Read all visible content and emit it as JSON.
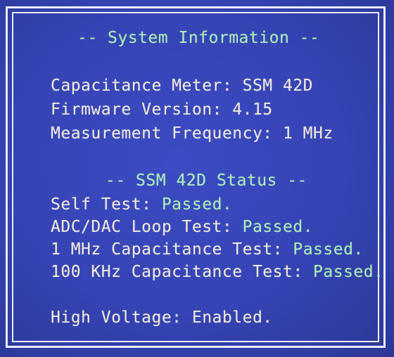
{
  "colors": {
    "background": "#3543b4",
    "frame": "#e9ecf6",
    "text": "#f0e9d8",
    "highlight": "#a8f0b3"
  },
  "header": {
    "title": "-- System Information --"
  },
  "info": {
    "meter": "Capacitance Meter: SSM 42D",
    "firmware": "Firmware Version: 4.15",
    "frequency": "Measurement Frequency: 1 MHz"
  },
  "status": {
    "title": "-- SSM 42D Status --",
    "tests": [
      {
        "label": "Self Test: ",
        "result": "Passed."
      },
      {
        "label": "ADC/DAC Loop Test: ",
        "result": "Passed."
      },
      {
        "label": "1 MHz Capacitance Test: ",
        "result": "Passed."
      },
      {
        "label": "100 KHz Capacitance Test: ",
        "result": "Passed."
      }
    ]
  },
  "voltage": {
    "text": "High Voltage: Enabled."
  }
}
